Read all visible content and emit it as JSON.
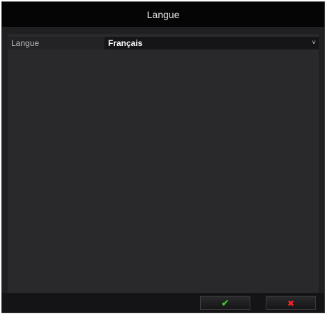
{
  "dialog": {
    "title": "Langue"
  },
  "settings": {
    "language_label": "Langue",
    "language_value": "Français"
  },
  "icons": {
    "dropdown": "chevron-down-icon",
    "ok": "checkmark-icon",
    "cancel": "close-icon"
  },
  "colors": {
    "ok": "#3fdc28",
    "cancel": "#ff2020",
    "title_bar": "#050505",
    "panel": "#29292b"
  }
}
